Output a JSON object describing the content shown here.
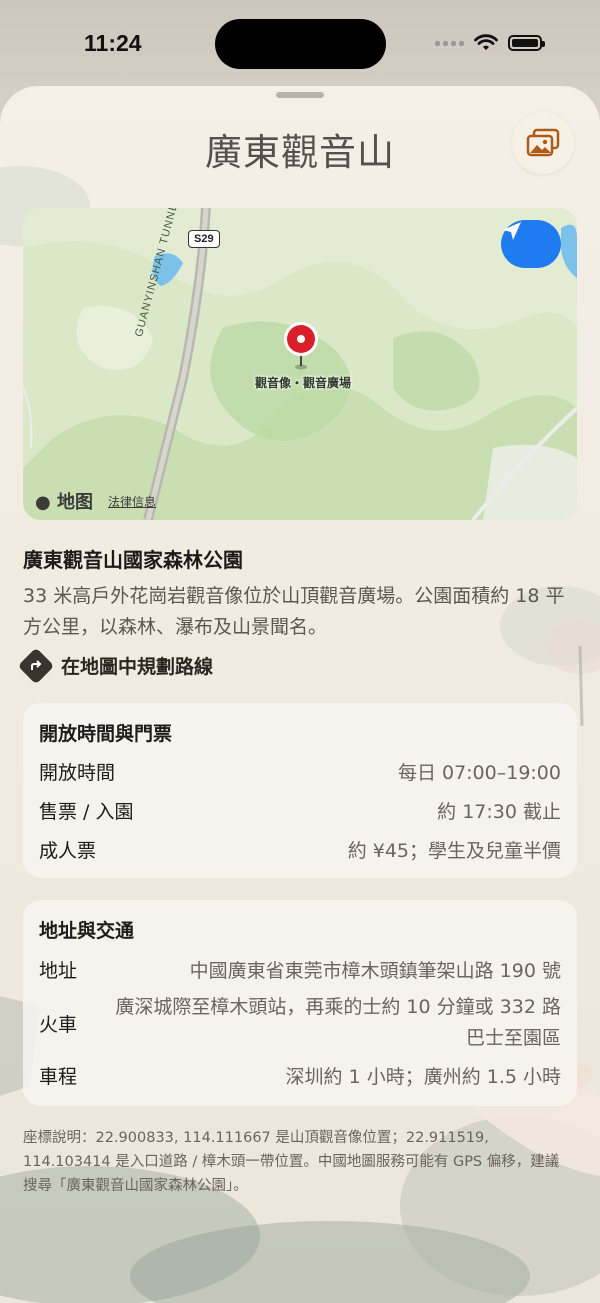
{
  "status_bar": {
    "time": "11:24"
  },
  "header": {
    "title": "廣東觀音山",
    "photo_button_icon": "photo-stack-icon"
  },
  "map": {
    "road_badge": "S29",
    "tunnel_label": "GUANYINSHAN TUNNEL",
    "pin_label": "觀音像・觀音廣場",
    "brand": "地图",
    "legal": "法律信息",
    "locate_icon": "location-arrow-icon"
  },
  "place": {
    "name": "廣東觀音山國家森林公園",
    "description": "33 米高戶外花崗岩觀音像位於山頂觀音廣場。公園面積約 18 平方公里，以森林、瀑布及山景聞名。",
    "route_label": "在地圖中規劃路線"
  },
  "hours_card": {
    "title": "開放時間與門票",
    "rows": [
      {
        "key": "開放時間",
        "value": "每日 07:00–19:00"
      },
      {
        "key": "售票 / 入園",
        "value": "約 17:30 截止"
      },
      {
        "key": "成人票",
        "value": "約 ¥45；學生及兒童半價"
      }
    ]
  },
  "transport_card": {
    "title": "地址與交通",
    "rows": [
      {
        "key": "地址",
        "value": "中國廣東省東莞市樟木頭鎮筆架山路 190 號"
      },
      {
        "key": "火車",
        "value": "廣深城際至樟木頭站，再乘的士約 10 分鐘或 332 路巴士至園區"
      },
      {
        "key": "車程",
        "value": "深圳約 1 小時；廣州約 1.5 小時"
      }
    ]
  },
  "footnote": "座標說明：22.900833, 114.111667 是山頂觀音像位置；22.911519, 114.103414 是入口道路 / 樟木頭一帶位置。中國地圖服務可能有 GPS 偏移，建議搜尋「廣東觀音山國家森林公園」。",
  "colors": {
    "accent": "#1f7cf0",
    "pin": "#d9202a",
    "sheet_bg": "#f1ebe2"
  }
}
